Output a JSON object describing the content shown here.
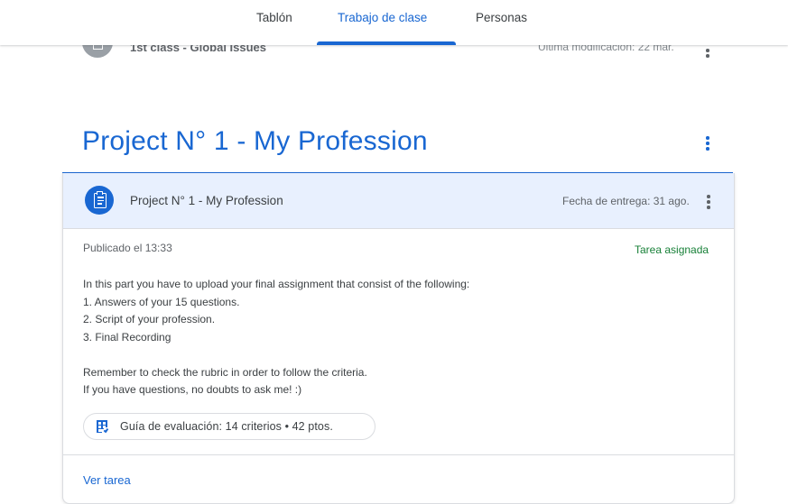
{
  "tabs": [
    {
      "label": "Tablón",
      "active": false
    },
    {
      "label": "Trabajo de clase",
      "active": true
    },
    {
      "label": "Personas",
      "active": false
    }
  ],
  "previous_item": {
    "title": "1st class - Global Issues",
    "modified": "Última modificación: 22 mar.",
    "icon": "assignment-icon"
  },
  "topic": {
    "title": "Project N° 1 - My Profession"
  },
  "assignment": {
    "title": "Project N° 1 - My Profession",
    "due": "Fecha de entrega: 31 ago.",
    "published": "Publicado el 13:33",
    "status": "Tarea asignada",
    "description": [
      "In this part you have to upload your final assignment that consist of the following:",
      "1. Answers of your 15 questions.",
      "2. Script of your profession.",
      "3. Final Recording",
      "",
      "Remember to check the rubric in order to follow the criteria.",
      "If you have questions, no doubts to ask me! :)"
    ],
    "rubric_label": "Guía de evaluación: 14 criterios • 42 ptos.",
    "view_link": "Ver tarea"
  },
  "colors": {
    "accent": "#1967d2",
    "header_bg": "#e8f0fe",
    "status_green": "#188038"
  }
}
